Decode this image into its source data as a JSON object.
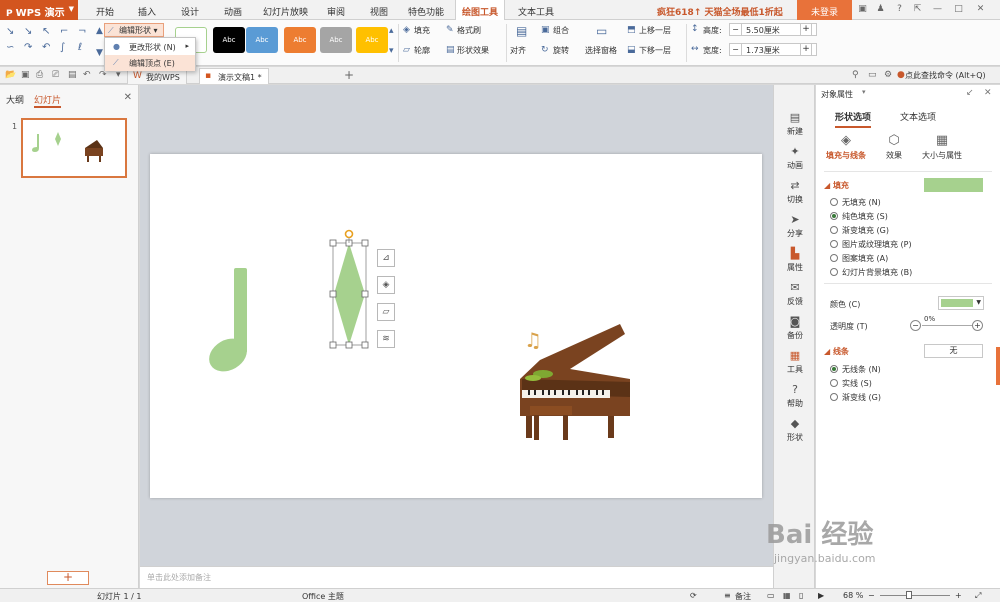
{
  "app": {
    "name": "WPS 演示"
  },
  "menu": {
    "tabs": [
      "开始",
      "插入",
      "设计",
      "动画",
      "幻灯片放映",
      "审阅",
      "视图",
      "特色功能",
      "绘图工具",
      "文本工具"
    ],
    "active": "绘图工具",
    "promo": "疯狂618↑ 天猫全场最低1折起",
    "login": "未登录"
  },
  "ribbon": {
    "edit_shape": "编辑形状",
    "style_text": "Abc",
    "fill": "填充",
    "format_brush": "格式刷",
    "outline": "轮廓",
    "shape_effect": "形状效果",
    "align": "对齐",
    "group": "组合",
    "rotate": "旋转",
    "selection_pane": "选择窗格",
    "bring_forward": "上移一层",
    "send_backward": "下移一层",
    "height_label": "高度:",
    "height_value": "5.50厘米",
    "width_label": "宽度:",
    "width_value": "1.73厘米"
  },
  "dropdown": {
    "change_shape": "更改形状 (N)",
    "edit_points": "编辑顶点 (E)"
  },
  "toolbar": {
    "tab_mywps": "我的WPS",
    "tab_doc": "演示文稿1 *",
    "search_cmd": "点此查找命令 (Alt+Q)"
  },
  "left_panel": {
    "tab_outline": "大纲",
    "tab_slides": "幻灯片",
    "slide_number": "1"
  },
  "notes_placeholder": "单击此处添加备注",
  "side_strip": [
    "新建",
    "动画",
    "切换",
    "分享",
    "属性",
    "反馈",
    "备份",
    "工具",
    "帮助",
    "形状"
  ],
  "props": {
    "title": "对象属性",
    "tab_shape": "形状选项",
    "tab_text": "文本选项",
    "sub_fill": "填充与线条",
    "sub_effect": "效果",
    "sub_size": "大小与属性",
    "fill_header": "填充",
    "fill_options": [
      "无填充 (N)",
      "纯色填充 (S)",
      "渐变填充 (G)",
      "图片或纹理填充 (P)",
      "图案填充 (A)",
      "幻灯片背景填充 (B)"
    ],
    "fill_selected": 1,
    "color_label": "颜色 (C)",
    "transparency_label": "透明度 (T)",
    "transparency_value": "0%",
    "line_header": "线条",
    "line_value": "无",
    "line_options": [
      "无线条 (N)",
      "实线 (S)",
      "渐变线 (G)"
    ],
    "line_selected": 0
  },
  "status": {
    "slide_info": "幻灯片 1 / 1",
    "theme": "Office 主题",
    "notes": "备注",
    "zoom": "68 %"
  },
  "watermark": {
    "big": "Bai 经验",
    "small": "jingyan.baidu.com"
  },
  "colors": {
    "accent": "#c8582c",
    "shape_green": "#a6d18e",
    "app_orange": "#d3551f"
  }
}
